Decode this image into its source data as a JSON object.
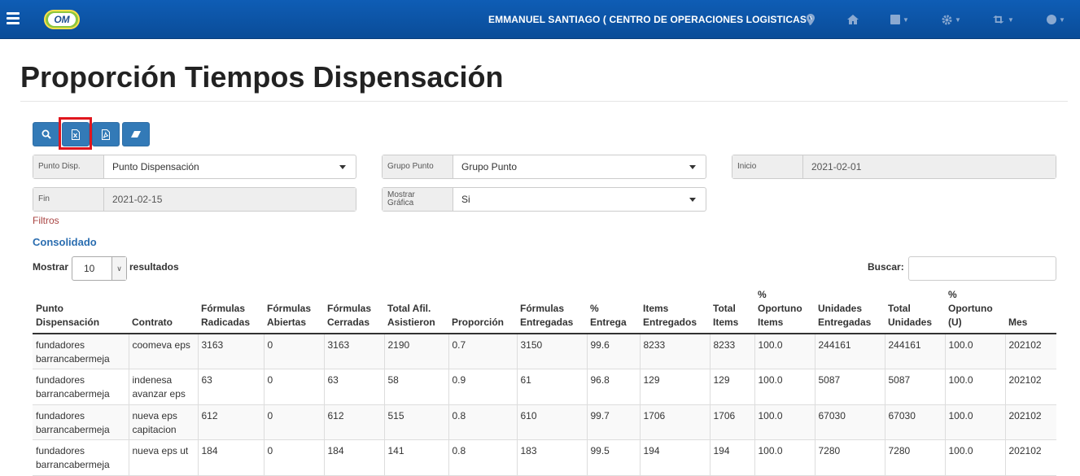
{
  "navbar": {
    "logo_text": "OM",
    "user_label": "EMMANUEL SANTIAGO ( CENTRO DE OPERACIONES LOGISTICAS )",
    "icons": [
      "map-marker-icon",
      "home-icon",
      "square-icon",
      "gear-icon",
      "retweet-icon",
      "circle-icon"
    ]
  },
  "page": {
    "title": "Proporción Tiempos Dispensación"
  },
  "toolbar": {
    "buttons": [
      "search-icon",
      "excel-icon",
      "pdf-icon",
      "eraser-icon"
    ]
  },
  "filters": {
    "punto_label": "Punto Disp.",
    "punto_value": "Punto Dispensación",
    "grupo_label": "Grupo Punto",
    "grupo_value": "Grupo Punto",
    "inicio_label": "Inicio",
    "inicio_value": "2021-02-01",
    "fin_label": "Fin",
    "fin_value": "2021-02-15",
    "grafica_label_1": "Mostrar",
    "grafica_label_2": "Gráfica",
    "grafica_value": "Si",
    "filtros_link": "Filtros"
  },
  "section_title": "Consolidado",
  "table_controls": {
    "show_label": "Mostrar",
    "page_length": "10",
    "results_label": "resultados",
    "search_label": "Buscar:",
    "search_value": ""
  },
  "table": {
    "headers": [
      [
        "Punto",
        "Dispensación"
      ],
      [
        "",
        "Contrato"
      ],
      [
        "Fórmulas",
        "Radicadas"
      ],
      [
        "Fórmulas",
        "Abiertas"
      ],
      [
        "Fórmulas",
        "Cerradas"
      ],
      [
        "Total Afil.",
        "Asistieron"
      ],
      [
        "",
        "Proporción"
      ],
      [
        "Fórmulas",
        "Entregadas"
      ],
      [
        "%",
        "Entrega"
      ],
      [
        "Items",
        "Entregados"
      ],
      [
        "Total",
        "Items"
      ],
      [
        "%",
        "Oportuno",
        "Items"
      ],
      [
        "Unidades",
        "Entregadas"
      ],
      [
        "Total",
        "Unidades"
      ],
      [
        "%",
        "Oportuno",
        "(U)"
      ],
      [
        "",
        "Mes"
      ]
    ],
    "rows": [
      [
        [
          "fundadores",
          "barrancabermeja"
        ],
        [
          "coomeva eps"
        ],
        [
          "3163"
        ],
        [
          "0"
        ],
        [
          "3163"
        ],
        [
          "2190"
        ],
        [
          "0.7"
        ],
        [
          "3150"
        ],
        [
          "99.6"
        ],
        [
          "8233"
        ],
        [
          "8233"
        ],
        [
          "100.0"
        ],
        [
          "244161"
        ],
        [
          "244161"
        ],
        [
          "100.0"
        ],
        [
          "202102"
        ]
      ],
      [
        [
          "fundadores",
          "barrancabermeja"
        ],
        [
          "indenesa",
          "avanzar eps"
        ],
        [
          "63"
        ],
        [
          "0"
        ],
        [
          "63"
        ],
        [
          "58"
        ],
        [
          "0.9"
        ],
        [
          "61"
        ],
        [
          "96.8"
        ],
        [
          "129"
        ],
        [
          "129"
        ],
        [
          "100.0"
        ],
        [
          "5087"
        ],
        [
          "5087"
        ],
        [
          "100.0"
        ],
        [
          "202102"
        ]
      ],
      [
        [
          "fundadores",
          "barrancabermeja"
        ],
        [
          "nueva eps",
          "capitacion"
        ],
        [
          "612"
        ],
        [
          "0"
        ],
        [
          "612"
        ],
        [
          "515"
        ],
        [
          "0.8"
        ],
        [
          "610"
        ],
        [
          "99.7"
        ],
        [
          "1706"
        ],
        [
          "1706"
        ],
        [
          "100.0"
        ],
        [
          "67030"
        ],
        [
          "67030"
        ],
        [
          "100.0"
        ],
        [
          "202102"
        ]
      ],
      [
        [
          "fundadores",
          "barrancabermeja"
        ],
        [
          "nueva eps ut"
        ],
        [
          "184"
        ],
        [
          "0"
        ],
        [
          "184"
        ],
        [
          "141"
        ],
        [
          "0.8"
        ],
        [
          "183"
        ],
        [
          "99.5"
        ],
        [
          "194"
        ],
        [
          "194"
        ],
        [
          "100.0"
        ],
        [
          "7280"
        ],
        [
          "7280"
        ],
        [
          "100.0"
        ],
        [
          "202102"
        ]
      ]
    ]
  }
}
